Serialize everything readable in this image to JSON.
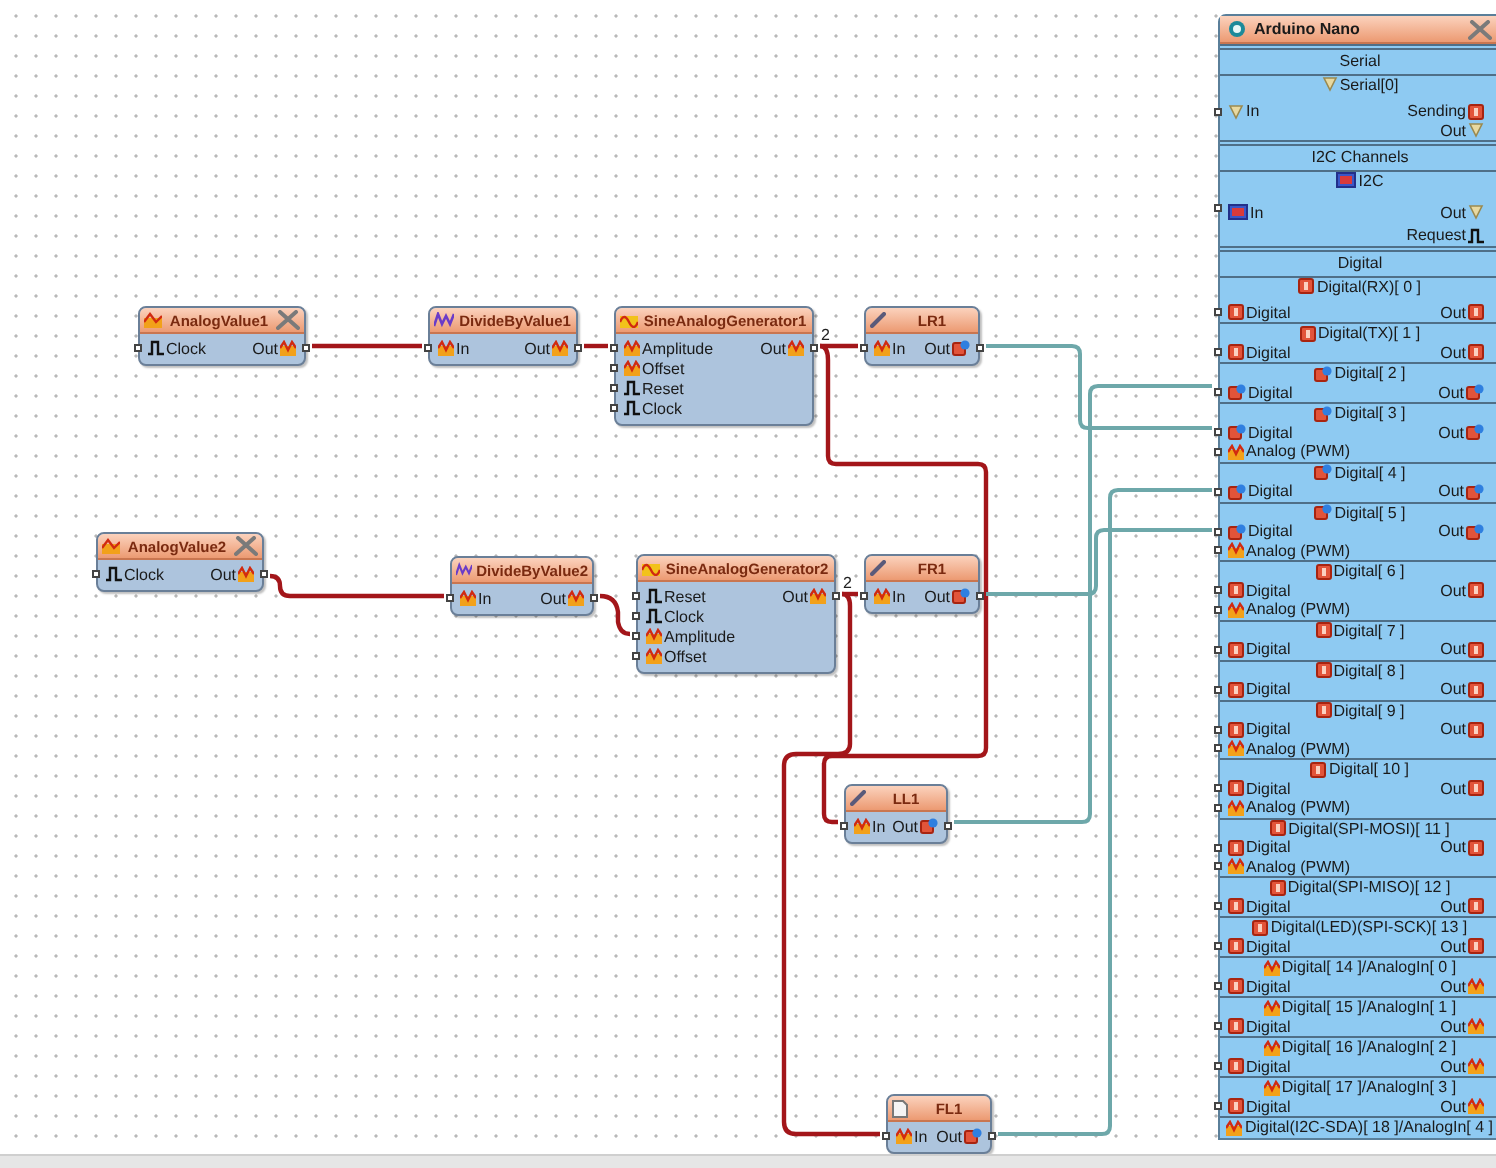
{
  "nodes": [
    {
      "title": "AnalogValue1",
      "kind": "value",
      "inputs": [
        {
          "label": "Clock",
          "kind": "clock"
        }
      ],
      "outputs": [
        {
          "label": "Out",
          "kind": "analog"
        }
      ]
    },
    {
      "title": "DivideByValue1",
      "kind": "math",
      "inputs": [
        {
          "label": "In",
          "kind": "analog"
        }
      ],
      "outputs": [
        {
          "label": "Out",
          "kind": "analog"
        }
      ]
    },
    {
      "title": "SineAnalogGenerator1",
      "kind": "generator",
      "inputs": [
        {
          "label": "Amplitude",
          "kind": "analog"
        },
        {
          "label": "Offset",
          "kind": "analog"
        },
        {
          "label": "Reset",
          "kind": "clock"
        },
        {
          "label": "Clock",
          "kind": "clock"
        }
      ],
      "outputs": [
        {
          "label": "Out",
          "kind": "analog",
          "count": "2"
        }
      ]
    },
    {
      "title": "LR1",
      "kind": "servo",
      "inputs": [
        {
          "label": "In",
          "kind": "analog"
        }
      ],
      "outputs": [
        {
          "label": "Out",
          "kind": "digital"
        }
      ]
    },
    {
      "title": "AnalogValue2",
      "kind": "value",
      "inputs": [
        {
          "label": "Clock",
          "kind": "clock"
        }
      ],
      "outputs": [
        {
          "label": "Out",
          "kind": "analog"
        }
      ]
    },
    {
      "title": "DivideByValue2",
      "kind": "math",
      "inputs": [
        {
          "label": "In",
          "kind": "analog"
        }
      ],
      "outputs": [
        {
          "label": "Out",
          "kind": "analog"
        }
      ]
    },
    {
      "title": "SineAnalogGenerator2",
      "kind": "generator",
      "inputs": [
        {
          "label": "Reset",
          "kind": "clock"
        },
        {
          "label": "Clock",
          "kind": "clock"
        },
        {
          "label": "Amplitude",
          "kind": "analog"
        },
        {
          "label": "Offset",
          "kind": "analog"
        }
      ],
      "outputs": [
        {
          "label": "Out",
          "kind": "analog",
          "count": "2"
        }
      ]
    },
    {
      "title": "FR1",
      "kind": "servo",
      "inputs": [
        {
          "label": "In",
          "kind": "analog"
        }
      ],
      "outputs": [
        {
          "label": "Out",
          "kind": "digital"
        }
      ]
    },
    {
      "title": "LL1",
      "kind": "servo",
      "inputs": [
        {
          "label": "In",
          "kind": "analog"
        }
      ],
      "outputs": [
        {
          "label": "Out",
          "kind": "digital"
        }
      ]
    },
    {
      "title": "FL1",
      "kind": "page",
      "inputs": [
        {
          "label": "In",
          "kind": "analog"
        }
      ],
      "outputs": [
        {
          "label": "Out",
          "kind": "digital"
        }
      ]
    }
  ],
  "board": {
    "title": "Arduino Nano",
    "sections": [
      {
        "heading": "Serial",
        "channels": [
          {
            "title": "Serial[0]",
            "kind": "serial",
            "pins": [
              {
                "left": {
                  "label": "In",
                  "kind": "serial"
                },
                "right": {
                  "label": "Sending",
                  "kind": "digital"
                }
              },
              {
                "right": {
                  "label": "Out",
                  "kind": "serial"
                }
              }
            ]
          }
        ]
      },
      {
        "heading": "I2C Channels",
        "channels": [
          {
            "title": "I2C",
            "kind": "i2c",
            "pins": [
              {
                "left": {
                  "label": "In",
                  "kind": "i2c"
                },
                "right": {
                  "label": "Out",
                  "kind": "serial"
                }
              },
              {
                "right": {
                  "label": "Request",
                  "kind": "clock"
                }
              }
            ]
          }
        ]
      },
      {
        "heading": "Digital",
        "channels": [
          {
            "title": "Digital(RX)[ 0 ]",
            "kind": "digital",
            "connected": false,
            "pins": [
              {
                "left": {
                  "label": "Digital",
                  "kind": "digital"
                },
                "right": {
                  "label": "Out",
                  "kind": "digital"
                }
              }
            ]
          },
          {
            "title": "Digital(TX)[ 1 ]",
            "kind": "digital",
            "connected": false,
            "pins": [
              {
                "left": {
                  "label": "Digital",
                  "kind": "digital"
                },
                "right": {
                  "label": "Out",
                  "kind": "digital"
                }
              }
            ]
          },
          {
            "title": "Digital[ 2 ]",
            "kind": "digital",
            "connected": true,
            "pins": [
              {
                "left": {
                  "label": "Digital",
                  "kind": "digital"
                },
                "right": {
                  "label": "Out",
                  "kind": "digital"
                }
              }
            ]
          },
          {
            "title": "Digital[ 3 ]",
            "kind": "digital",
            "connected": true,
            "pins": [
              {
                "left": {
                  "label": "Digital",
                  "kind": "digital"
                },
                "right": {
                  "label": "Out",
                  "kind": "digital"
                }
              },
              {
                "left": {
                  "label": "Analog (PWM)",
                  "kind": "analog"
                }
              }
            ]
          },
          {
            "title": "Digital[ 4 ]",
            "kind": "digital",
            "connected": true,
            "pins": [
              {
                "left": {
                  "label": "Digital",
                  "kind": "digital"
                },
                "right": {
                  "label": "Out",
                  "kind": "digital"
                }
              }
            ]
          },
          {
            "title": "Digital[ 5 ]",
            "kind": "digital",
            "connected": true,
            "pins": [
              {
                "left": {
                  "label": "Digital",
                  "kind": "digital"
                },
                "right": {
                  "label": "Out",
                  "kind": "digital"
                }
              },
              {
                "left": {
                  "label": "Analog (PWM)",
                  "kind": "analog"
                }
              }
            ]
          },
          {
            "title": "Digital[ 6 ]",
            "kind": "digital",
            "connected": false,
            "pins": [
              {
                "left": {
                  "label": "Digital",
                  "kind": "digital"
                },
                "right": {
                  "label": "Out",
                  "kind": "digital"
                }
              },
              {
                "left": {
                  "label": "Analog (PWM)",
                  "kind": "analog"
                }
              }
            ]
          },
          {
            "title": "Digital[ 7 ]",
            "kind": "digital",
            "connected": false,
            "pins": [
              {
                "left": {
                  "label": "Digital",
                  "kind": "digital"
                },
                "right": {
                  "label": "Out",
                  "kind": "digital"
                }
              }
            ]
          },
          {
            "title": "Digital[ 8 ]",
            "kind": "digital",
            "connected": false,
            "pins": [
              {
                "left": {
                  "label": "Digital",
                  "kind": "digital"
                },
                "right": {
                  "label": "Out",
                  "kind": "digital"
                }
              }
            ]
          },
          {
            "title": "Digital[ 9 ]",
            "kind": "digital",
            "connected": false,
            "pins": [
              {
                "left": {
                  "label": "Digital",
                  "kind": "digital"
                },
                "right": {
                  "label": "Out",
                  "kind": "digital"
                }
              },
              {
                "left": {
                  "label": "Analog (PWM)",
                  "kind": "analog"
                }
              }
            ]
          },
          {
            "title": "Digital[ 10 ]",
            "kind": "digital",
            "connected": false,
            "pins": [
              {
                "left": {
                  "label": "Digital",
                  "kind": "digital"
                },
                "right": {
                  "label": "Out",
                  "kind": "digital"
                }
              },
              {
                "left": {
                  "label": "Analog (PWM)",
                  "kind": "analog"
                }
              }
            ]
          },
          {
            "title": "Digital(SPI-MOSI)[ 11 ]",
            "kind": "digital",
            "connected": false,
            "pins": [
              {
                "left": {
                  "label": "Digital",
                  "kind": "digital"
                },
                "right": {
                  "label": "Out",
                  "kind": "digital"
                }
              },
              {
                "left": {
                  "label": "Analog (PWM)",
                  "kind": "analog"
                }
              }
            ]
          },
          {
            "title": "Digital(SPI-MISO)[ 12 ]",
            "kind": "digital",
            "connected": false,
            "pins": [
              {
                "left": {
                  "label": "Digital",
                  "kind": "digital"
                },
                "right": {
                  "label": "Out",
                  "kind": "digital"
                }
              }
            ]
          },
          {
            "title": "Digital(LED)(SPI-SCK)[ 13 ]",
            "kind": "digital",
            "connected": false,
            "pins": [
              {
                "left": {
                  "label": "Digital",
                  "kind": "digital"
                },
                "right": {
                  "label": "Out",
                  "kind": "digital"
                }
              }
            ]
          },
          {
            "title": "Digital[ 14 ]/AnalogIn[ 0 ]",
            "kind": "analog",
            "pins": [
              {
                "left": {
                  "label": "Digital",
                  "kind": "digital"
                },
                "right": {
                  "label": "Out",
                  "kind": "analog"
                }
              }
            ]
          },
          {
            "title": "Digital[ 15 ]/AnalogIn[ 1 ]",
            "kind": "analog",
            "pins": [
              {
                "left": {
                  "label": "Digital",
                  "kind": "digital"
                },
                "right": {
                  "label": "Out",
                  "kind": "analog"
                }
              }
            ]
          },
          {
            "title": "Digital[ 16 ]/AnalogIn[ 2 ]",
            "kind": "analog",
            "pins": [
              {
                "left": {
                  "label": "Digital",
                  "kind": "digital"
                },
                "right": {
                  "label": "Out",
                  "kind": "analog"
                }
              }
            ]
          },
          {
            "title": "Digital[ 17 ]/AnalogIn[ 3 ]",
            "kind": "analog",
            "pins": [
              {
                "left": {
                  "label": "Digital",
                  "kind": "digital"
                },
                "right": {
                  "label": "Out",
                  "kind": "analog"
                }
              }
            ]
          },
          {
            "title": "Digital(I2C-SDA)[ 18 ]/AnalogIn[ 4 ]",
            "kind": "analog"
          }
        ]
      }
    ]
  }
}
